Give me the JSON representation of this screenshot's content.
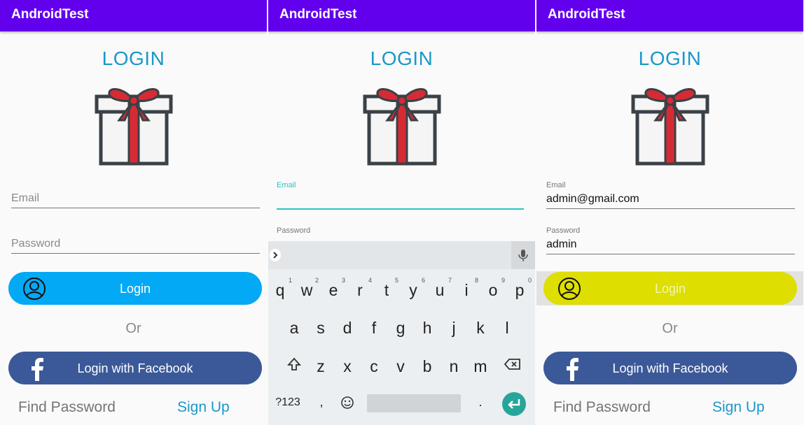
{
  "app_title": "AndroidTest",
  "login_title": "LOGIN",
  "panel1": {
    "email": {
      "hint": "Email"
    },
    "password": {
      "hint": "Password"
    }
  },
  "panel2": {
    "email": {
      "label": "Email"
    },
    "password": {
      "label": "Password"
    }
  },
  "panel3": {
    "email": {
      "label": "Email",
      "value": "admin@gmail.com"
    },
    "password": {
      "label": "Password",
      "value": "admin"
    }
  },
  "buttons": {
    "login": "Login",
    "or": "Or",
    "facebook": "Login with Facebook",
    "find_password": "Find Password",
    "sign_up": "Sign Up"
  },
  "keyboard": {
    "row1": [
      "q",
      "w",
      "e",
      "r",
      "t",
      "y",
      "u",
      "i",
      "o",
      "p"
    ],
    "row1_digits": [
      "1",
      "2",
      "3",
      "4",
      "5",
      "6",
      "7",
      "8",
      "9",
      "0"
    ],
    "row2": [
      "a",
      "s",
      "d",
      "f",
      "g",
      "h",
      "j",
      "k",
      "l"
    ],
    "row3": [
      "z",
      "x",
      "c",
      "v",
      "b",
      "n",
      "m"
    ],
    "symbols_key": "?123",
    "comma": ",",
    "period": "."
  },
  "colors": {
    "appbar": "#6200ee",
    "title": "#1a98c8",
    "login_button": "#03a9f4",
    "login_button_pressed": "#dede00",
    "facebook": "#3b5998",
    "focus_accent": "#27c4c0"
  }
}
